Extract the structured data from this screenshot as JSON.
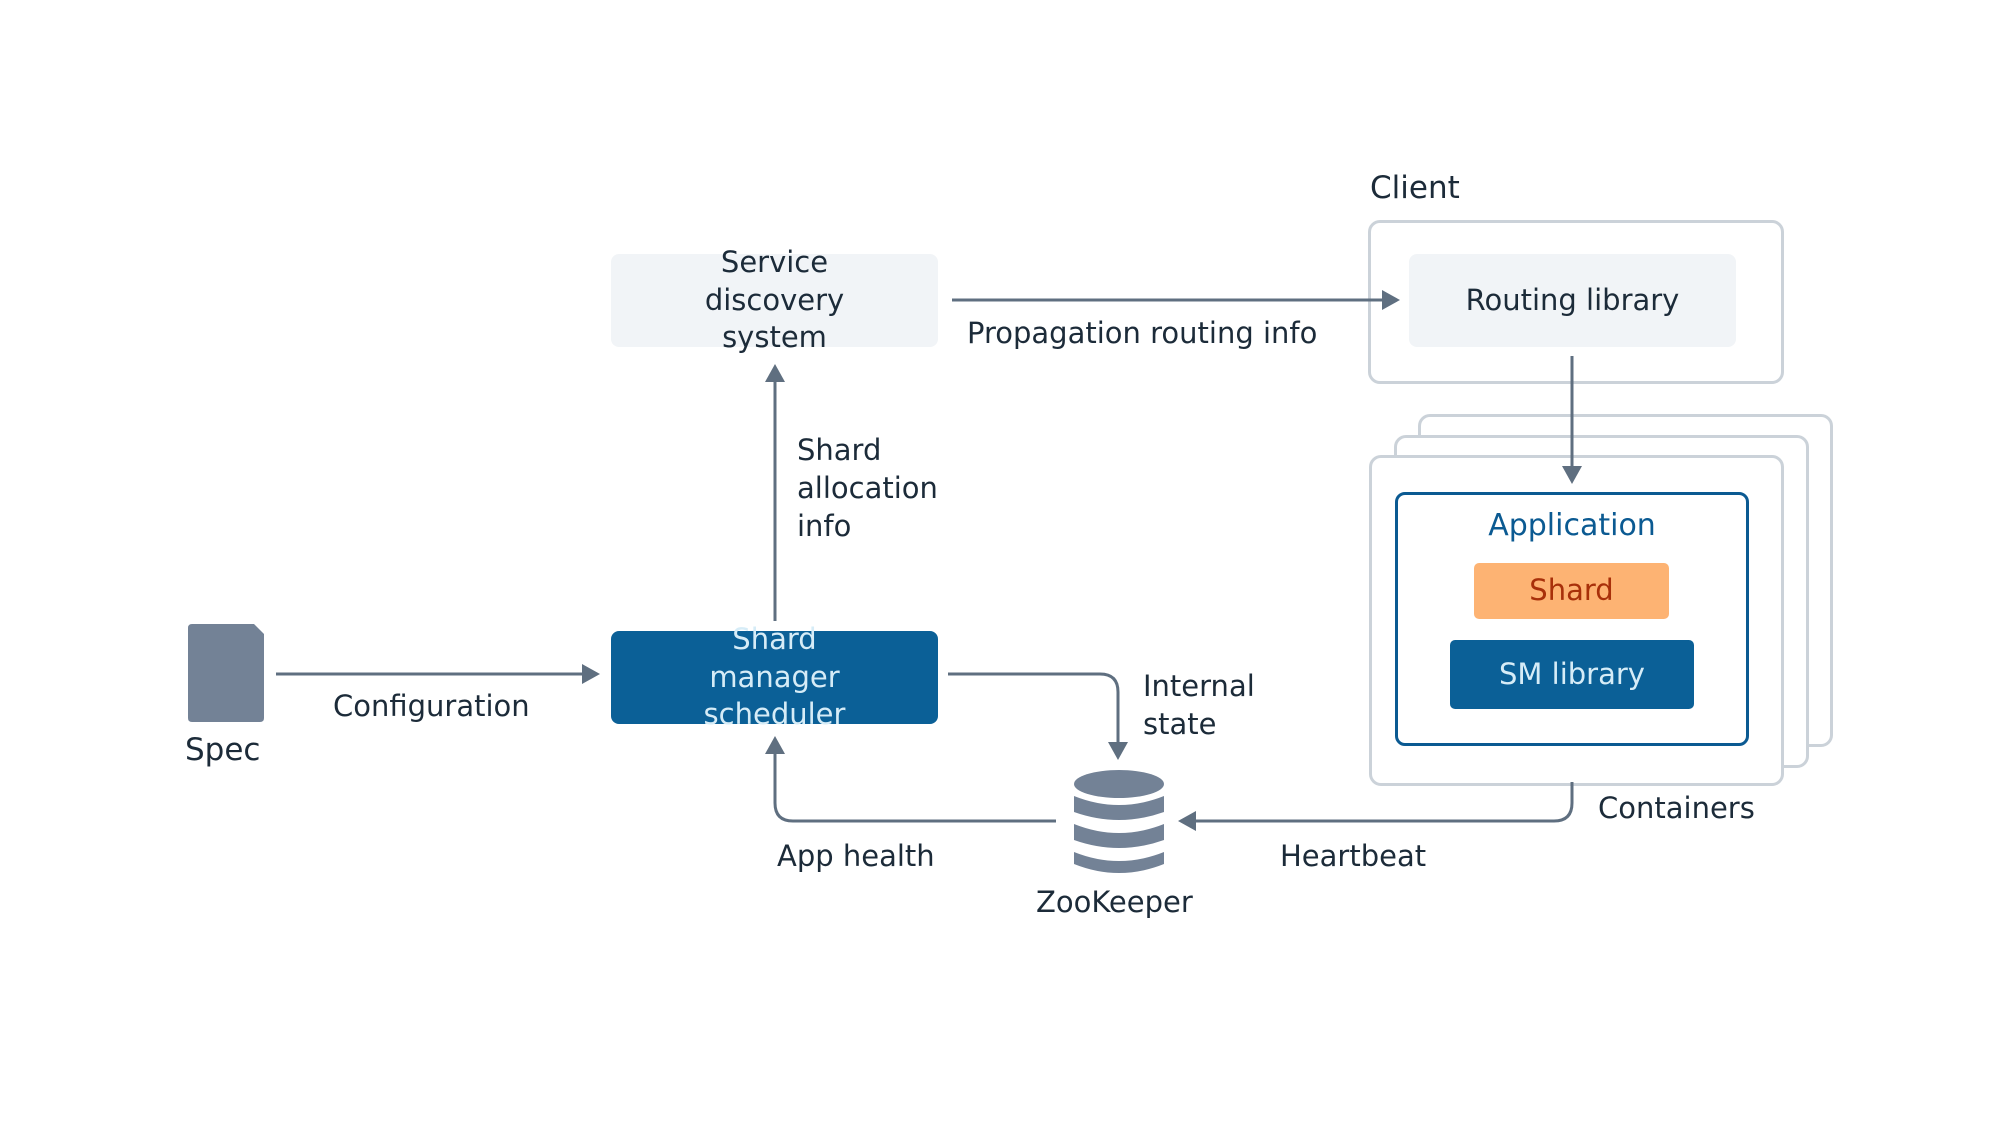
{
  "nodes": {
    "spec": "Spec",
    "service_discovery": "Service discovery system",
    "shard_manager_scheduler": "Shard manager scheduler",
    "zookeeper": "ZooKeeper",
    "client": "Client",
    "routing_library": "Routing library",
    "application": "Application",
    "shard": "Shard",
    "sm_library": "SM library",
    "containers": "Containers"
  },
  "edges": {
    "configuration": "Configuration",
    "shard_allocation_info_1": "Shard",
    "shard_allocation_info_2": "allocation",
    "shard_allocation_info_3": "info",
    "propagation_routing_info": "Propagation routing info",
    "internal_state_1": "Internal",
    "internal_state_2": "state",
    "app_health": "App health",
    "heartbeat": "Heartbeat"
  },
  "colors": {
    "arrow": "#5f6f80",
    "scheduler_fill": "#0b6097",
    "shard_fill": "#fdb373",
    "shard_text": "#a8300a",
    "application_border": "#0b5a92",
    "container_border": "#cbd2d9",
    "light_fill": "#f1f4f7",
    "icon_fill": "#738296"
  }
}
